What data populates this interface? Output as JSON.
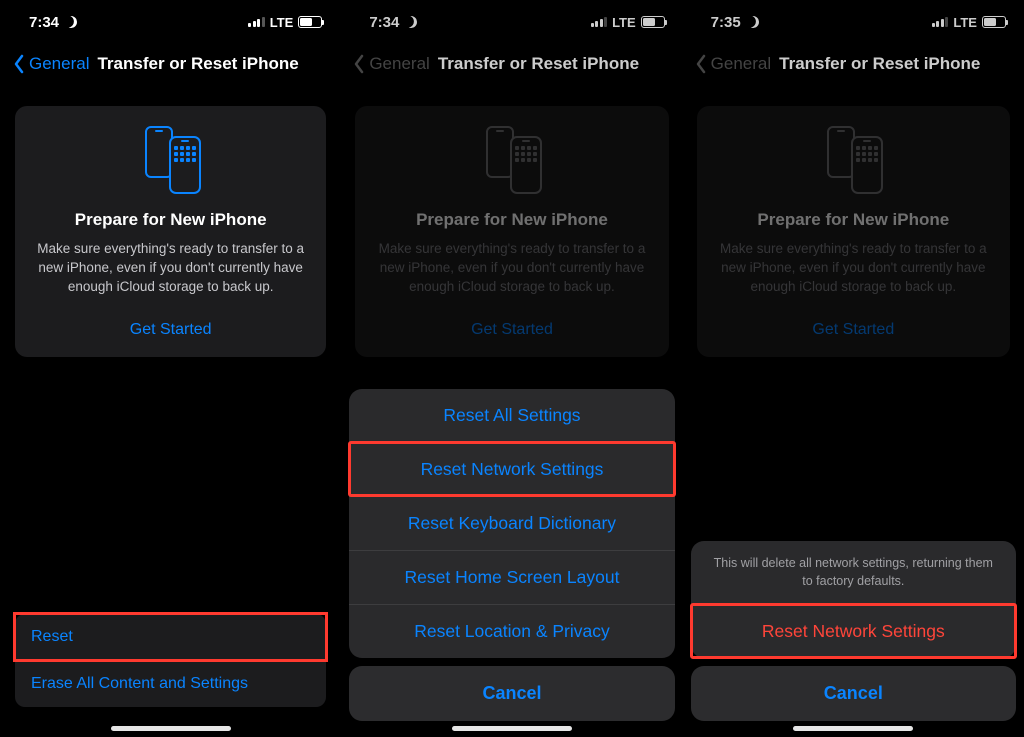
{
  "screens": [
    {
      "status": {
        "time": "7:34",
        "network": "LTE"
      },
      "nav": {
        "back": "General",
        "title": "Transfer or Reset iPhone",
        "muted": false
      },
      "card": {
        "heading": "Prepare for New iPhone",
        "body": "Make sure everything's ready to transfer to a new iPhone, even if you don't currently have enough iCloud storage to back up.",
        "cta": "Get Started"
      },
      "list": [
        {
          "label": "Reset",
          "highlight": true
        },
        {
          "label": "Erase All Content and Settings",
          "highlight": false
        }
      ]
    },
    {
      "status": {
        "time": "7:34",
        "network": "LTE"
      },
      "nav": {
        "back": "General",
        "title": "Transfer or Reset iPhone",
        "muted": true
      },
      "card": {
        "heading": "Prepare for New iPhone",
        "body": "Make sure everything's ready to transfer to a new iPhone, even if you don't currently have enough iCloud storage to back up.",
        "cta": "Get Started"
      },
      "sheet": {
        "options": [
          {
            "label": "Reset All Settings",
            "highlight": false
          },
          {
            "label": "Reset Network Settings",
            "highlight": true
          },
          {
            "label": "Reset Keyboard Dictionary",
            "highlight": false
          },
          {
            "label": "Reset Home Screen Layout",
            "highlight": false
          },
          {
            "label": "Reset Location & Privacy",
            "highlight": false
          }
        ],
        "cancel": "Cancel"
      }
    },
    {
      "status": {
        "time": "7:35",
        "network": "LTE"
      },
      "nav": {
        "back": "General",
        "title": "Transfer or Reset iPhone",
        "muted": true
      },
      "card": {
        "heading": "Prepare for New iPhone",
        "body": "Make sure everything's ready to transfer to a new iPhone, even if you don't currently have enough iCloud storage to back up.",
        "cta": "Get Started"
      },
      "confirm": {
        "message": "This will delete all network settings, returning them to factory defaults.",
        "action": "Reset Network Settings",
        "cancel": "Cancel"
      }
    }
  ]
}
